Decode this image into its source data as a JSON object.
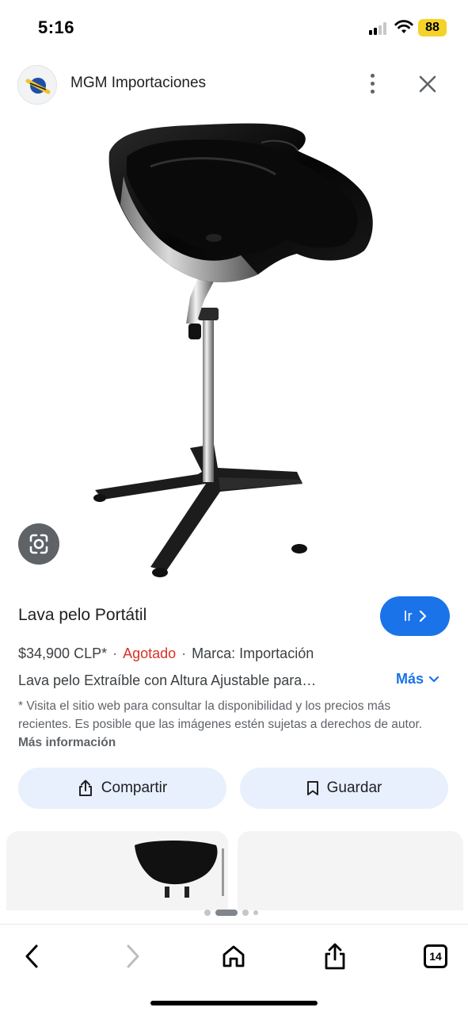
{
  "status_bar": {
    "time": "5:16",
    "battery": "88"
  },
  "header": {
    "site_name": "MGM Importaciones",
    "icons": {
      "logo": "site-logo-icon",
      "menu": "more-vert-icon",
      "close": "close-icon"
    }
  },
  "product": {
    "title": "Lava pelo Portátil",
    "go_label": "Ir",
    "price": "$34,900 CLP*",
    "availability": "Agotado",
    "brand": "Marca: Importación",
    "description": "Lava pelo Extraíble con Altura Ajustable para…",
    "more_label": "Más",
    "disclaimer": "* Visita el sitio web para consultar la disponibilidad y los precios más recientes. Es posible que las imágenes estén sujetas a derechos de autor.",
    "more_info_label": "Más información"
  },
  "actions": {
    "share_label": "Compartir",
    "save_label": "Guardar"
  },
  "toolbar": {
    "tab_count": "14",
    "icons": [
      "back-icon",
      "forward-icon",
      "home-icon",
      "share-icon",
      "tabs-icon"
    ]
  },
  "colors": {
    "accent": "#1a73e8",
    "sold_out": "#d93025",
    "button_bg": "#e8f0fe",
    "battery": "#f5d229"
  }
}
